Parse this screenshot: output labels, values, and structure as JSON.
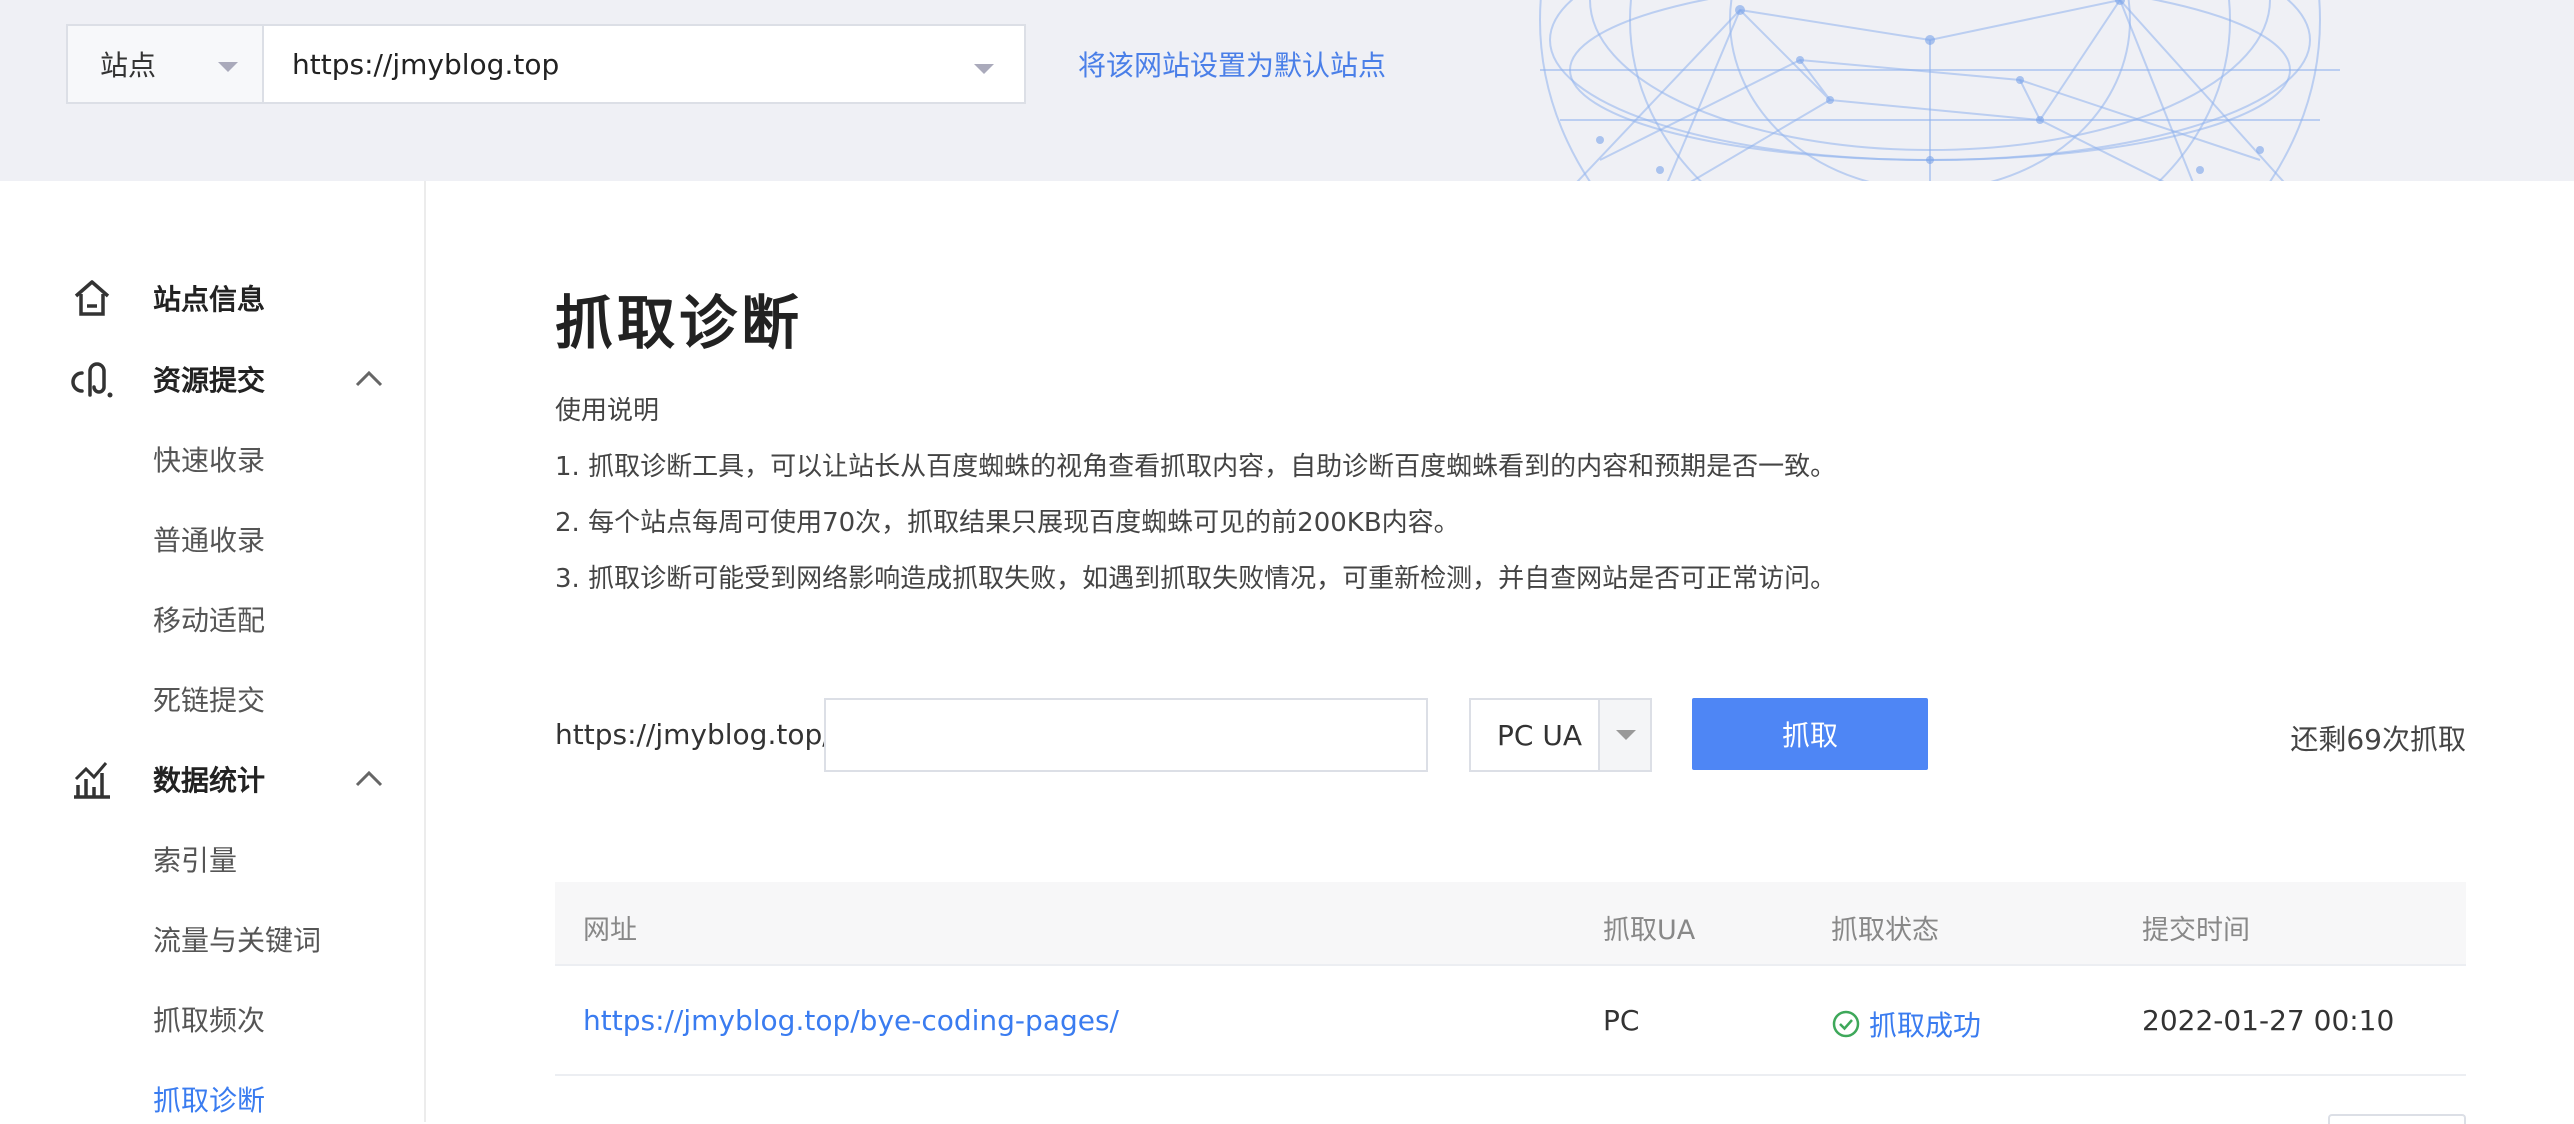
{
  "header": {
    "site_type": "站点",
    "site_url": "https://jmyblog.top",
    "set_default_link": "将该网站设置为默认站点"
  },
  "sidebar": {
    "site_info": "站点信息",
    "resource_submit": {
      "label": "资源提交",
      "items": [
        "快速收录",
        "普通收录",
        "移动适配",
        "死链提交"
      ]
    },
    "data_stats": {
      "label": "数据统计",
      "items": [
        "索引量",
        "流量与关键词",
        "抓取频次",
        "抓取诊断"
      ],
      "active": "抓取诊断"
    }
  },
  "main": {
    "title": "抓取诊断",
    "instructions": [
      "使用说明",
      "1. 抓取诊断工具，可以让站长从百度蜘蛛的视角查看抓取内容，自助诊断百度蜘蛛看到的内容和预期是否一致。",
      "2. 每个站点每周可使用70次，抓取结果只展现百度蜘蛛可见的前200KB内容。",
      "3. 抓取诊断可能受到网络影响造成抓取失败，如遇到抓取失败情况，可重新检测，并自查网站是否可正常访问。"
    ],
    "fetch": {
      "url_prefix": "https://jmyblog.top/",
      "input_value": "",
      "ua_selected": "PC UA",
      "button_label": "抓取",
      "remaining_text": "还剩69次抓取"
    },
    "table": {
      "headers": [
        "网址",
        "抓取UA",
        "抓取状态",
        "提交时间"
      ],
      "rows": [
        {
          "url": "https://jmyblog.top/bye-coding-pages/",
          "ua": "PC",
          "status": "抓取成功",
          "time": "2022-01-27 00:10"
        }
      ]
    }
  },
  "colors": {
    "accent": "#4e86f5",
    "link": "#3a7cf0",
    "header_bg": "#eff0f5"
  }
}
